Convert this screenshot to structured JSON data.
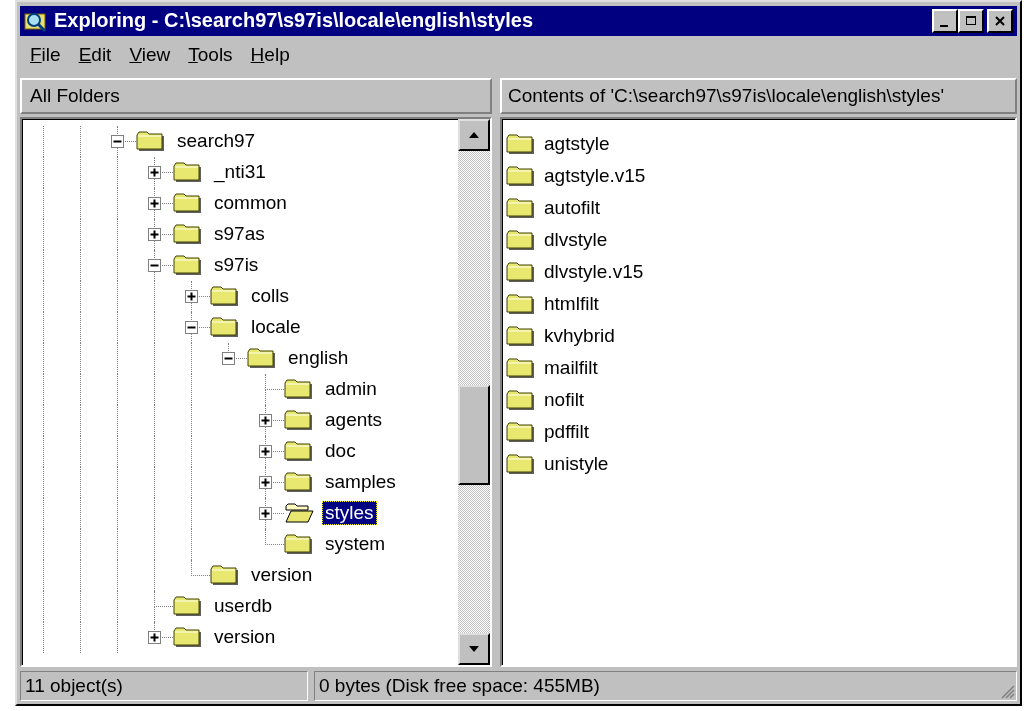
{
  "window": {
    "title": "Exploring - C:\\search97\\s97is\\locale\\english\\styles"
  },
  "menu": [
    {
      "label": "File"
    },
    {
      "label": "Edit"
    },
    {
      "label": "View"
    },
    {
      "label": "Tools"
    },
    {
      "label": "Help"
    }
  ],
  "left_header": "All Folders",
  "right_header": "Contents of 'C:\\search97\\s97is\\locale\\english\\styles'",
  "tree": [
    {
      "label": "search97",
      "kind": "expandable",
      "expanded": true,
      "selected": false,
      "children": [
        {
          "label": "_nti31",
          "kind": "expandable",
          "expanded": false,
          "selected": false
        },
        {
          "label": "common",
          "kind": "expandable",
          "expanded": false,
          "selected": false
        },
        {
          "label": "s97as",
          "kind": "expandable",
          "expanded": false,
          "selected": false
        },
        {
          "label": "s97is",
          "kind": "expandable",
          "expanded": true,
          "selected": false,
          "children": [
            {
              "label": "colls",
              "kind": "expandable",
              "expanded": false,
              "selected": false
            },
            {
              "label": "locale",
              "kind": "expandable",
              "expanded": true,
              "selected": false,
              "children": [
                {
                  "label": "english",
                  "kind": "expandable",
                  "expanded": true,
                  "selected": false,
                  "children": [
                    {
                      "label": "admin",
                      "kind": "leaf",
                      "selected": false
                    },
                    {
                      "label": "agents",
                      "kind": "expandable",
                      "expanded": false,
                      "selected": false
                    },
                    {
                      "label": "doc",
                      "kind": "expandable",
                      "expanded": false,
                      "selected": false
                    },
                    {
                      "label": "samples",
                      "kind": "expandable",
                      "expanded": false,
                      "selected": false
                    },
                    {
                      "label": "styles",
                      "kind": "expandable",
                      "expanded": false,
                      "selected": true
                    },
                    {
                      "label": "system",
                      "kind": "leaf",
                      "selected": false
                    }
                  ]
                }
              ]
            },
            {
              "label": "version",
              "kind": "leaf",
              "selected": false
            }
          ]
        },
        {
          "label": "userdb",
          "kind": "leaf",
          "selected": false
        },
        {
          "label": "version",
          "kind": "expandable",
          "expanded": false,
          "selected": false
        }
      ]
    }
  ],
  "contents": [
    {
      "name": "agtstyle"
    },
    {
      "name": "agtstyle.v15"
    },
    {
      "name": "autofilt"
    },
    {
      "name": "dlvstyle"
    },
    {
      "name": "dlvstyle.v15"
    },
    {
      "name": "htmlfilt"
    },
    {
      "name": "kvhybrid"
    },
    {
      "name": "mailfilt"
    },
    {
      "name": "nofilt"
    },
    {
      "name": "pdffilt"
    },
    {
      "name": "unistyle"
    }
  ],
  "status_bar": [
    "11 object(s)",
    "0 bytes (Disk free space: 455MB)"
  ]
}
